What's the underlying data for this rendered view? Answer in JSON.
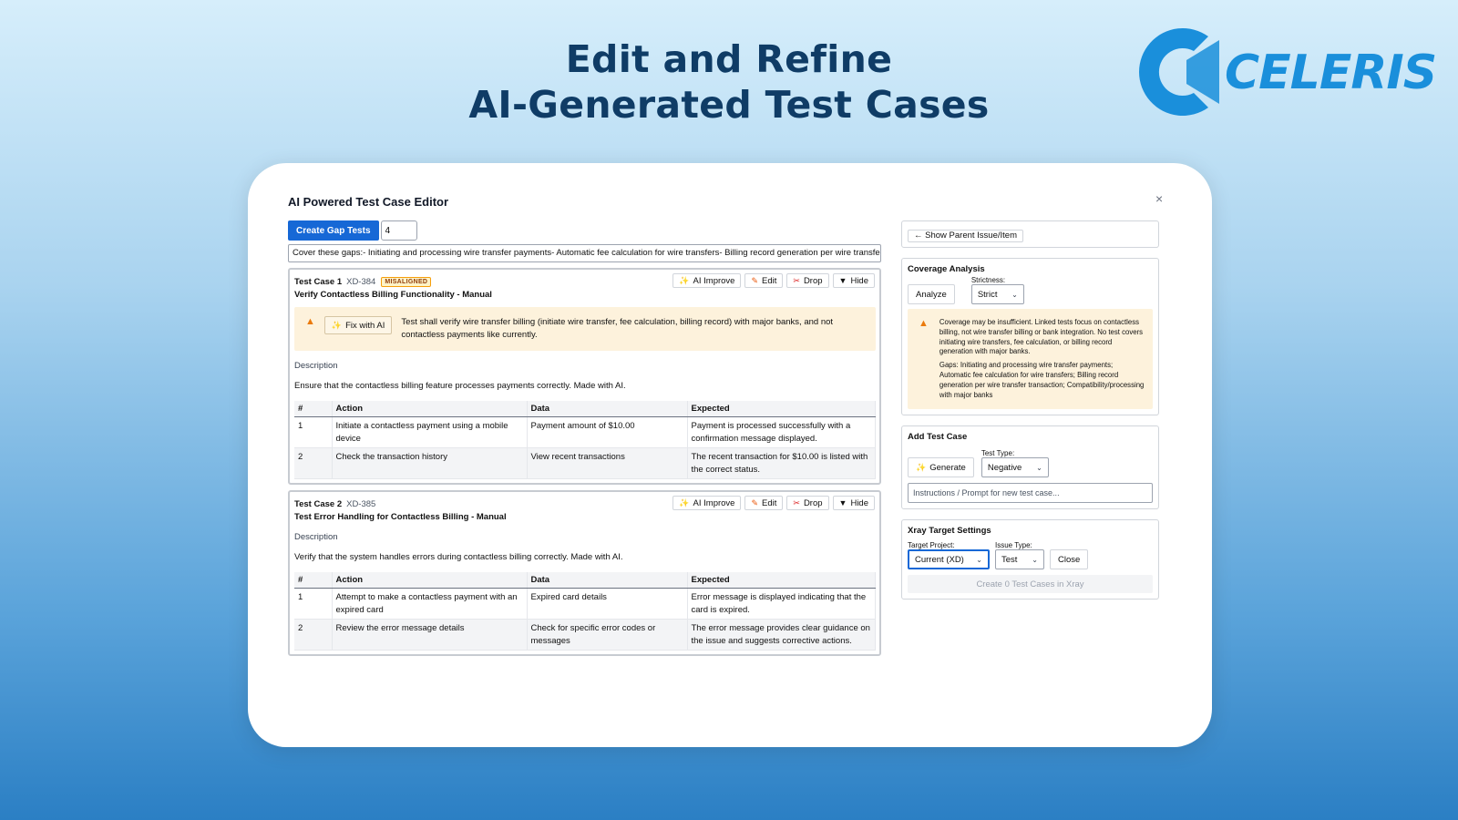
{
  "hero": {
    "line1": "Edit and Refine",
    "line2": "AI-Generated Test Cases"
  },
  "logo": {
    "text": "CELERIS",
    "color": "#1a8fdb"
  },
  "editor": {
    "title": "AI Powered Test Case Editor",
    "close": "×",
    "create_gap_label": "Create Gap Tests",
    "gap_count": "4",
    "gaps_text": "Cover these gaps:- Initiating and processing wire transfer payments- Automatic fee calculation for wire transfers- Billing record generation per wire transfer transaction- Compatibility/processing with major banks",
    "actions": {
      "ai_improve": "AI Improve",
      "edit": "Edit",
      "drop": "Drop",
      "hide": "Hide"
    },
    "icons": {
      "spark": "sparkles-icon",
      "pencil": "pencil-icon",
      "scissors": "scissors-icon",
      "triangle": "triangle-down-icon"
    },
    "columns": [
      "#",
      "Action",
      "Data",
      "Expected"
    ],
    "description_label": "Description",
    "test_cases": [
      {
        "num": "Test Case 1",
        "key": "XD-384",
        "badge": "MISALIGNED",
        "title": "Verify Contactless Billing Functionality - Manual",
        "fix_label": "Fix with AI",
        "warning": "Test shall verify wire transfer billing (initiate wire transfer, fee calculation, billing record) with major banks, and not contactless payments like currently.",
        "description": "Ensure that the contactless billing feature processes payments correctly. Made with AI.",
        "steps": [
          {
            "n": "1",
            "action": "Initiate a contactless payment using a mobile device",
            "data": "Payment amount of $10.00",
            "expected": "Payment is processed successfully with a confirmation message displayed."
          },
          {
            "n": "2",
            "action": "Check the transaction history",
            "data": "View recent transactions",
            "expected": "The recent transaction for $10.00 is listed with the correct status."
          }
        ]
      },
      {
        "num": "Test Case 2",
        "key": "XD-385",
        "title": "Test Error Handling for Contactless Billing - Manual",
        "description": "Verify that the system handles errors during contactless billing correctly. Made with AI.",
        "steps": [
          {
            "n": "1",
            "action": "Attempt to make a contactless payment with an expired card",
            "data": "Expired card details",
            "expected": "Error message is displayed indicating that the card is expired."
          },
          {
            "n": "2",
            "action": "Review the error message details",
            "data": "Check for specific error codes or messages",
            "expected": "The error message provides clear guidance on the issue and suggests corrective actions."
          }
        ]
      }
    ]
  },
  "sidebar": {
    "show_parent": "← Show Parent Issue/Item",
    "coverage": {
      "title": "Coverage Analysis",
      "analyze": "Analyze",
      "strictness_label": "Strictness:",
      "strictness_value": "Strict",
      "warning": "Coverage may be insufficient. Linked tests focus on contactless billing, not wire transfer billing or bank integration. No test covers initiating wire transfers, fee calculation, or billing record generation with major banks.",
      "gaps": "Gaps: Initiating and processing wire transfer payments; Automatic fee calculation for wire transfers; Billing record generation per wire transfer transaction; Compatibility/processing with major banks"
    },
    "add_test": {
      "title": "Add Test Case",
      "generate": "Generate",
      "type_label": "Test Type:",
      "type_value": "Negative",
      "prompt_placeholder": "Instructions / Prompt for new test case..."
    },
    "xray": {
      "title": "Xray Target Settings",
      "project_label": "Target Project:",
      "project_value": "Current (XD)",
      "issue_label": "Issue Type:",
      "issue_value": "Test",
      "close": "Close",
      "create": "Create 0 Test Cases in Xray"
    }
  }
}
